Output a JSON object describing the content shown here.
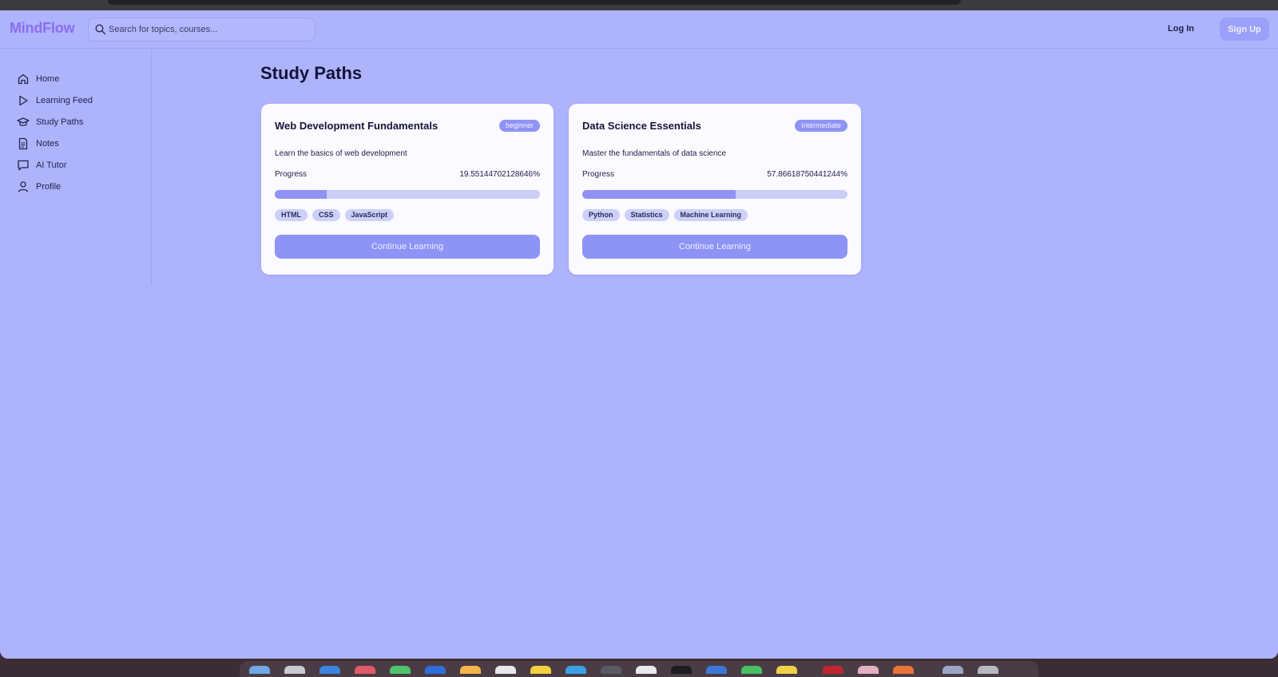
{
  "header": {
    "logo": "MindFlow",
    "search_placeholder": "Search for topics, courses...",
    "login_label": "Log In",
    "signup_label": "Sign Up"
  },
  "sidebar": {
    "items": [
      {
        "label": "Home",
        "icon": "home-icon"
      },
      {
        "label": "Learning Feed",
        "icon": "play-icon"
      },
      {
        "label": "Study Paths",
        "icon": "graduation-cap-icon"
      },
      {
        "label": "Notes",
        "icon": "document-icon"
      },
      {
        "label": "AI Tutor",
        "icon": "chat-icon"
      },
      {
        "label": "Profile",
        "icon": "user-icon"
      }
    ]
  },
  "main": {
    "title": "Study Paths",
    "cards": [
      {
        "title": "Web Development Fundamentals",
        "level": "beginner",
        "description": "Learn the basics of web development",
        "progress_label": "Progress",
        "progress_text": "19.55144702128646%",
        "progress_value": 19.55144702128646,
        "tags": [
          "HTML",
          "CSS",
          "JavaScript"
        ],
        "cta": "Continue Learning"
      },
      {
        "title": "Data Science Essentials",
        "level": "intermediate",
        "description": "Master the fundamentals of data science",
        "progress_label": "Progress",
        "progress_text": "57.86618750441244%",
        "progress_value": 57.86618750441244,
        "tags": [
          "Python",
          "Statistics",
          "Machine Learning"
        ],
        "cta": "Continue Learning"
      }
    ]
  },
  "colors": {
    "background": "#aeb4fc",
    "accent": "#8e93f6",
    "logo": "#8a6df0",
    "card": "#fafaff"
  }
}
